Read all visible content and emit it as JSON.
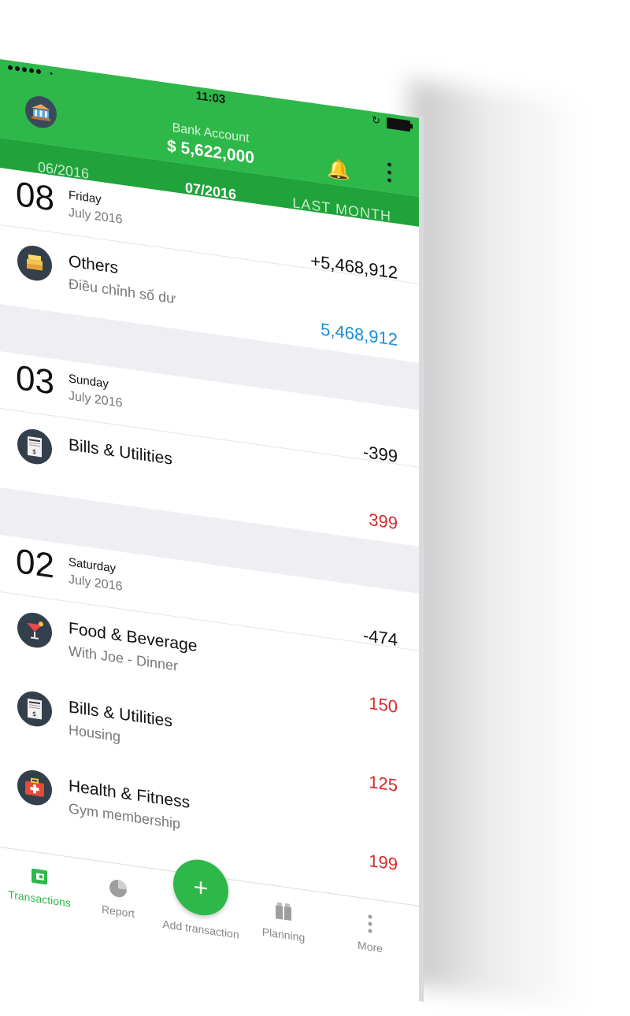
{
  "status_bar": {
    "time": "11:03"
  },
  "header": {
    "account_name": "Bank Account",
    "balance": "$ 5,622,000"
  },
  "month_tabs": {
    "previous": "06/2016",
    "current": "07/2016",
    "next": "LAST MONTH"
  },
  "days": [
    {
      "day": "08",
      "weekday": "Friday",
      "month_year": "July 2016",
      "total": "+5,468,912",
      "transactions": [
        {
          "category": "Others",
          "note": "Điều chỉnh số dư",
          "amount": "5,468,912",
          "kind": "income",
          "icon": "coins-icon"
        }
      ]
    },
    {
      "day": "03",
      "weekday": "Sunday",
      "month_year": "July 2016",
      "total": "-399",
      "transactions": [
        {
          "category": "Bills & Utilities",
          "note": "",
          "amount": "399",
          "kind": "expense",
          "icon": "bill-icon"
        }
      ]
    },
    {
      "day": "02",
      "weekday": "Saturday",
      "month_year": "July 2016",
      "total": "-474",
      "transactions": [
        {
          "category": "Food & Beverage",
          "note": "With Joe - Dinner",
          "amount": "150",
          "kind": "expense",
          "icon": "cocktail-icon"
        },
        {
          "category": "Bills & Utilities",
          "note": "Housing",
          "amount": "125",
          "kind": "expense",
          "icon": "bill-icon"
        },
        {
          "category": "Health & Fitness",
          "note": "Gym membership",
          "amount": "199",
          "kind": "expense",
          "icon": "first-aid-icon"
        }
      ]
    }
  ],
  "bottom_nav": {
    "transactions": "Transactions",
    "report": "Report",
    "add": "Add transaction",
    "planning": "Planning",
    "more": "More"
  },
  "colors": {
    "brand_green": "#2fb84a",
    "income": "#1a8fd6",
    "expense": "#d62b2b"
  }
}
